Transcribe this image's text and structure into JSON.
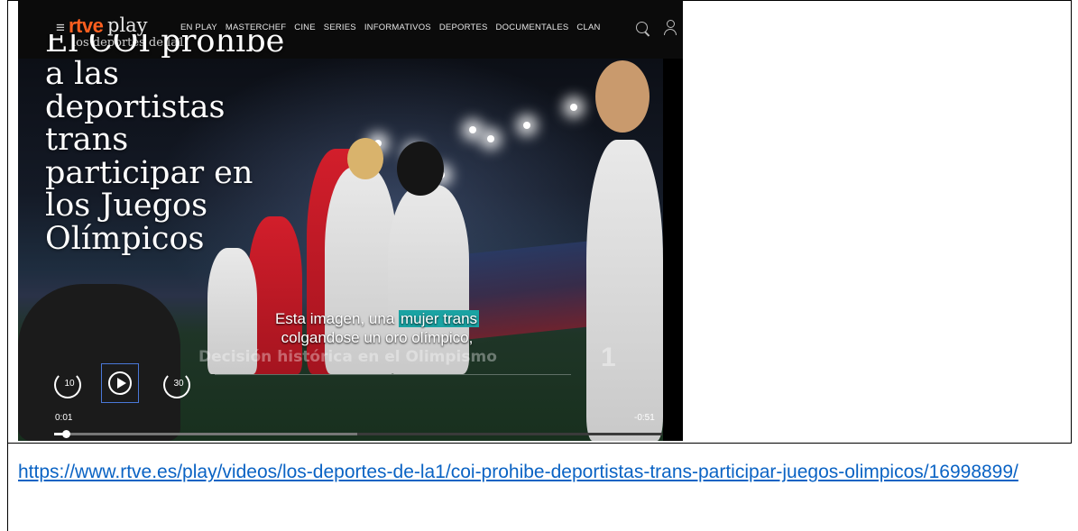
{
  "header": {
    "logo_brand": "rtve",
    "logo_product": "play",
    "logo_subtitle": "los deportes de la1",
    "nav_items": [
      "EN PLAY",
      "MASTERCHEF",
      "CINE",
      "SERIES",
      "INFORMATIVOS",
      "DEPORTES",
      "DOCUMENTALES",
      "CLAN"
    ]
  },
  "video": {
    "headline_partial": "El COI prohíbe",
    "headline_lines": [
      "a las",
      "deportistas",
      "trans",
      "participar en",
      "los Juegos",
      "Olímpicos"
    ],
    "subtitle_line1_start": "Esta imagen, una ",
    "subtitle_highlight": "mujer trans",
    "subtitle_line2": "colgandose un oro olímpico,",
    "background_caption": "Decisión histórica en el Olimpismo",
    "background_counter": "1",
    "rewind_label": "10",
    "forward_label": "30",
    "time_current": "0:01",
    "time_remaining": "-0:51",
    "progress_fraction": 0.02
  },
  "link": {
    "url": "https://www.rtve.es/play/videos/los-deportes-de-la1/coi-prohibe-deportistas-trans-participar-juegos-olimpicos/16998899/"
  },
  "colors": {
    "brand_orange": "#ff5f1f",
    "highlight_teal": "#1aa3a3",
    "link_blue": "#0a63c4"
  }
}
